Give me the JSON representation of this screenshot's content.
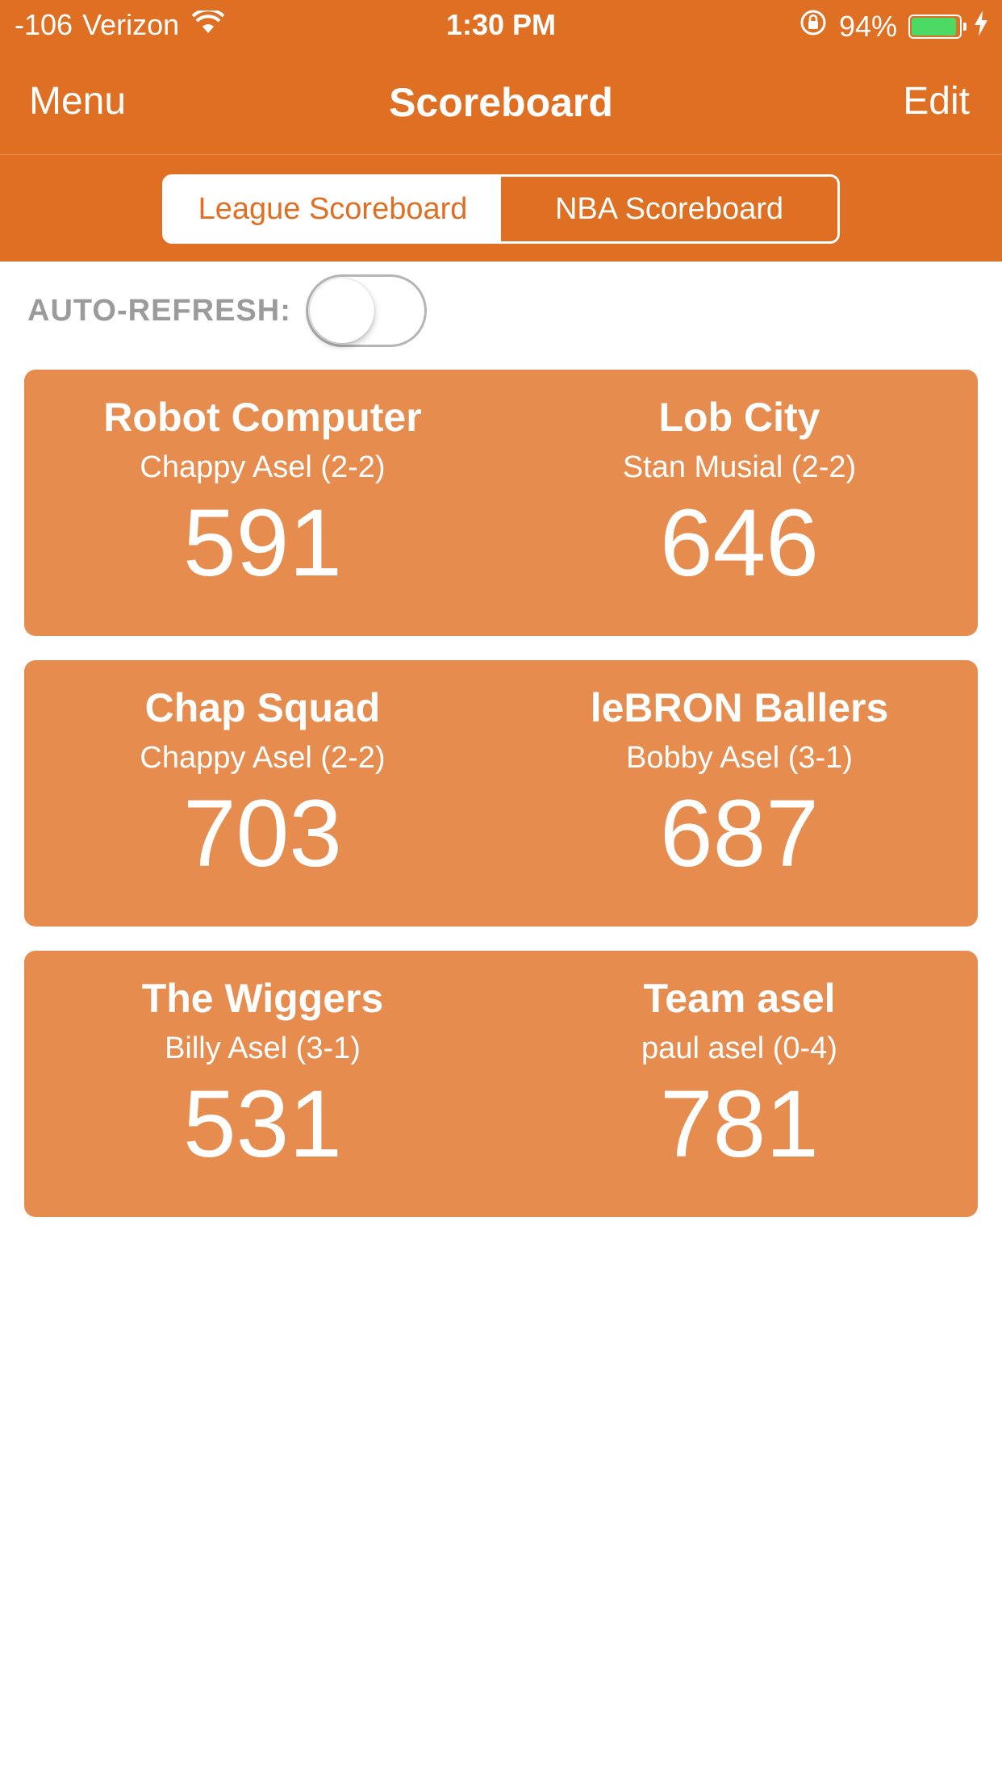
{
  "status_bar": {
    "signal": "-106",
    "carrier": "Verizon",
    "time": "1:30 PM",
    "battery": "94%",
    "battery_level": 0.94,
    "icons": [
      "wifi-icon",
      "rotation-lock-icon",
      "battery-icon",
      "charging-bolt-icon"
    ]
  },
  "nav": {
    "left_label": "Menu",
    "title": "Scoreboard",
    "right_label": "Edit"
  },
  "tabs": [
    {
      "label": "League Scoreboard",
      "selected": true
    },
    {
      "label": "NBA Scoreboard",
      "selected": false
    }
  ],
  "auto_refresh": {
    "label": "AUTO-REFRESH:",
    "enabled": false
  },
  "matchups": [
    {
      "home": {
        "team": "Robot Computer",
        "owner": "Chappy Asel (2-2)",
        "score": "591"
      },
      "away": {
        "team": "Lob City",
        "owner": "Stan Musial (2-2)",
        "score": "646"
      }
    },
    {
      "home": {
        "team": "Chap Squad",
        "owner": "Chappy Asel (2-2)",
        "score": "703"
      },
      "away": {
        "team": "leBRON Ballers",
        "owner": "Bobby Asel (3-1)",
        "score": "687"
      }
    },
    {
      "home": {
        "team": "The Wiggers",
        "owner": "Billy Asel (3-1)",
        "score": "531"
      },
      "away": {
        "team": "Team asel",
        "owner": "paul asel (0-4)",
        "score": "781"
      }
    }
  ],
  "colors": {
    "header": "#df6f22",
    "card": "#e68c4e",
    "toggle_off_border": "#b5b5b5",
    "label_gray": "#9b9b9b",
    "battery_fill": "#4cd964"
  }
}
